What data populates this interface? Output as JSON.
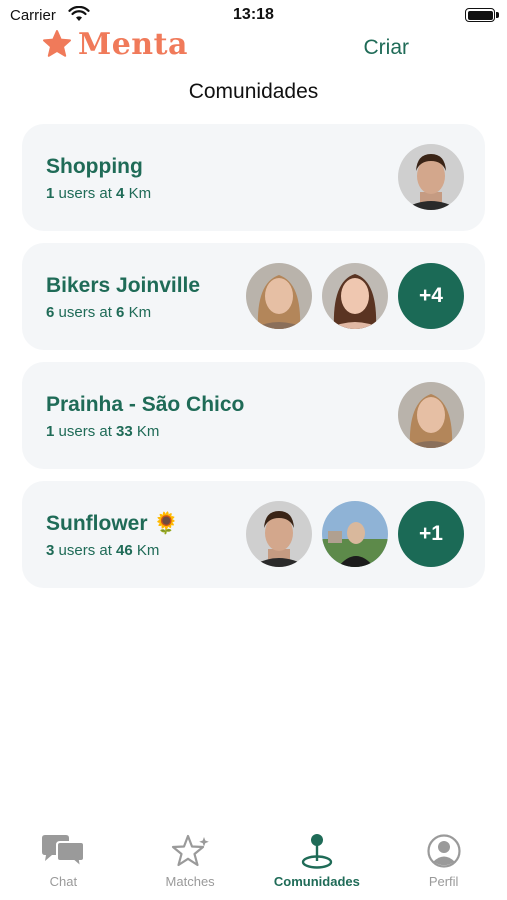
{
  "status_bar": {
    "carrier": "Carrier",
    "time": "13:18"
  },
  "header": {
    "logo_text": "Menta",
    "create_label": "Criar"
  },
  "page_title": "Comunidades",
  "communities": [
    {
      "name": "Shopping",
      "users": "1",
      "users_label": "users at",
      "distance": "4",
      "unit": "Km",
      "avatars": [
        "man-dark-hair"
      ],
      "more": ""
    },
    {
      "name": "Bikers Joinville",
      "users": "6",
      "users_label": "users at",
      "distance": "6",
      "unit": "Km",
      "avatars": [
        "woman-blonde",
        "woman-brown-hair"
      ],
      "more": "+4"
    },
    {
      "name": "Prainha - São Chico",
      "users": "1",
      "users_label": "users at",
      "distance": "33",
      "unit": "Km",
      "avatars": [
        "woman-blonde"
      ],
      "more": ""
    },
    {
      "name": "Sunflower 🌻",
      "users": "3",
      "users_label": "users at",
      "distance": "46",
      "unit": "Km",
      "avatars": [
        "man-dark-hair",
        "man-outdoor-photo"
      ],
      "more": "+1"
    }
  ],
  "tabs": [
    {
      "label": "Chat",
      "icon": "chat-bubbles-icon",
      "active": false
    },
    {
      "label": "Matches",
      "icon": "stars-icon",
      "active": false
    },
    {
      "label": "Comunidades",
      "icon": "map-pin-icon",
      "active": true
    },
    {
      "label": "Perfil",
      "icon": "profile-icon",
      "active": false
    }
  ],
  "colors": {
    "brand": "#f07a5a",
    "accent": "#1f6b57",
    "card_bg": "#f4f6f8",
    "inactive": "#9a9a9a"
  }
}
